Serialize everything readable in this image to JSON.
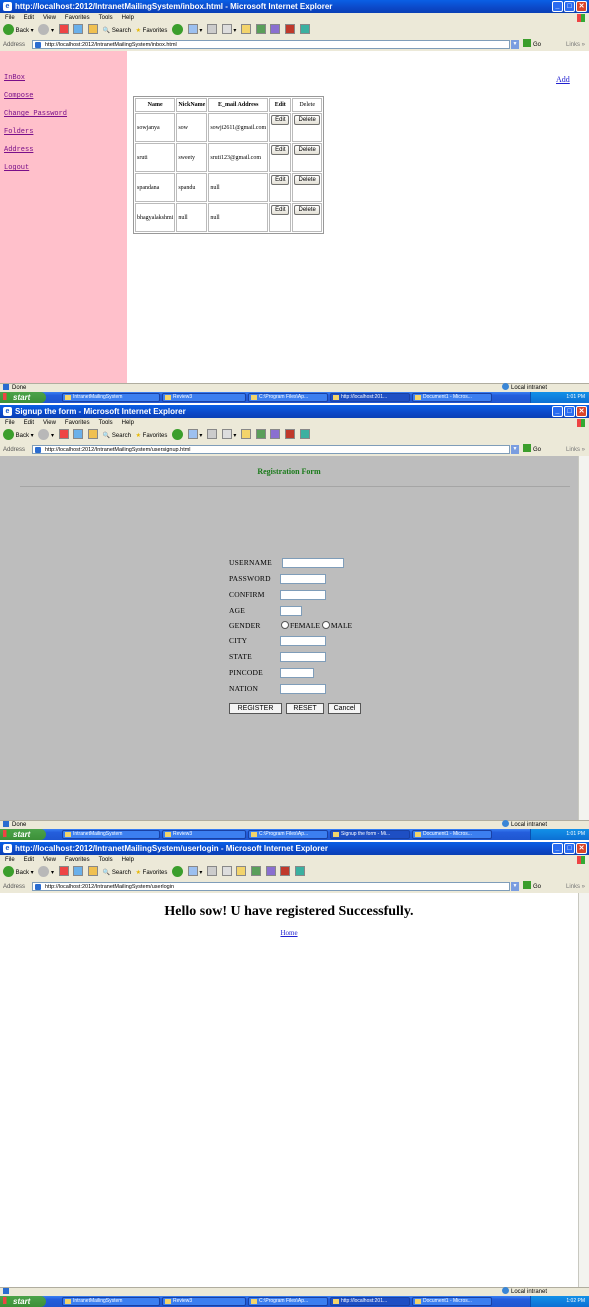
{
  "browser": {
    "menu": [
      "File",
      "Edit",
      "View",
      "Favorites",
      "Tools",
      "Help"
    ],
    "toolbar": {
      "back": "Back",
      "search": "Search",
      "favorites": "Favorites"
    },
    "address_label": "Address",
    "go": "Go",
    "links": "Links",
    "zone": "Local intranet"
  },
  "windows": [
    {
      "title": "http://localhost:2012/IntranetMailingSystem/inbox.html - Microsoft Internet Explorer",
      "url": "http://localhost:2012/IntranetMailingSystem/inbox.html",
      "status": "Done",
      "clock": "1:01 PM"
    },
    {
      "title": "Signup the form - Microsoft Internet Explorer",
      "url": "http://localhost:2012/IntranetMailingSystem/usersignup.html",
      "status": "Done",
      "clock": "1:01 PM"
    },
    {
      "title": "http://localhost:2012/IntranetMailingSystem/userlogin - Microsoft Internet Explorer",
      "url": "http://localhost:2012/IntranetMailingSystem/userlogin",
      "status": "",
      "clock": "1:02 PM"
    }
  ],
  "taskbar": {
    "start": "start",
    "tasks_1": [
      "IntranetMailingSystem",
      "Review3",
      "C:\\Program Files\\Ap...",
      "http://localhost:201...",
      "Document1 - Micros..."
    ],
    "tasks_2": [
      "IntranetMailingSystem",
      "Review3",
      "C:\\Program Files\\Ap...",
      "Signup the form - Mi...",
      "Document1 - Micros..."
    ],
    "tasks_3": [
      "IntranetMailingSystem",
      "Review3",
      "C:\\Program Files\\Ap...",
      "http://localhost:201...",
      "Document1 - Micros..."
    ]
  },
  "inbox": {
    "sidebar": [
      "InBox",
      "Compose",
      "Change Password",
      "Folders",
      "Address",
      "Logout"
    ],
    "add_link": "Add",
    "columns": [
      "Name",
      "NickName",
      "E_mail Address",
      "Edit",
      "Delete"
    ],
    "rows": [
      {
        "name": "sowjanya",
        "nick": "sow",
        "email": "sowji2611@gmail.com"
      },
      {
        "name": "sruti",
        "nick": "sweety",
        "email": "sruti123@gmail.com"
      },
      {
        "name": "spandana",
        "nick": "spandu",
        "email": "null"
      },
      {
        "name": "bhagyalakshmi",
        "nick": "null",
        "email": "null"
      }
    ],
    "edit_label": "Edit",
    "delete_label": "Delete"
  },
  "signup": {
    "heading": "Registration Form",
    "labels": {
      "username": "USERNAME",
      "password": "PASSWORD",
      "confirm": "CONFIRM",
      "age": "AGE",
      "gender": "GENDER",
      "city": "CITY",
      "state": "STATE",
      "pincode": "PINCODE",
      "nation": "NATION"
    },
    "gender_options": [
      "FEMALE",
      "MALE"
    ],
    "buttons": {
      "register": "REGISTER",
      "reset": "RESET",
      "cancel": "Cancel"
    }
  },
  "success": {
    "message": "Hello sow! U have registered Successfully.",
    "home_link": "Home"
  }
}
